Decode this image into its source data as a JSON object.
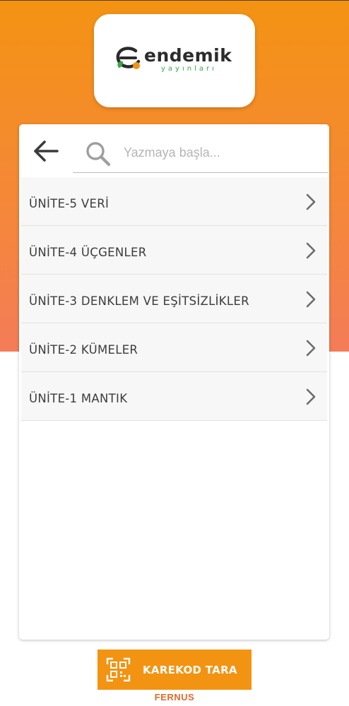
{
  "header": {
    "logo": {
      "wordmark": "endemik",
      "subtitle": "yayınları",
      "icon": "endemik-logo-icon"
    }
  },
  "search": {
    "placeholder": "Yazmaya başla...",
    "value": "",
    "back_icon": "arrow-left-icon",
    "search_icon": "search-icon"
  },
  "units": [
    {
      "label": "ÜNİTE-5 VERİ"
    },
    {
      "label": "ÜNİTE-4 ÜÇGENLER"
    },
    {
      "label": "ÜNİTE-3 DENKLEM VE EŞİTSİZLİKLER"
    },
    {
      "label": "ÜNİTE-2 KÜMELER"
    },
    {
      "label": "ÜNİTE-1 MANTIK"
    }
  ],
  "footer": {
    "scan_button_label": "KAREKOD TARA",
    "scan_icon": "qr-scan-icon",
    "brand": "FERNUS"
  },
  "colors": {
    "accent": "#f39312",
    "gradient_bottom": "#f47c58",
    "logo_green": "#3aa648",
    "text": "#3c3c3c"
  }
}
